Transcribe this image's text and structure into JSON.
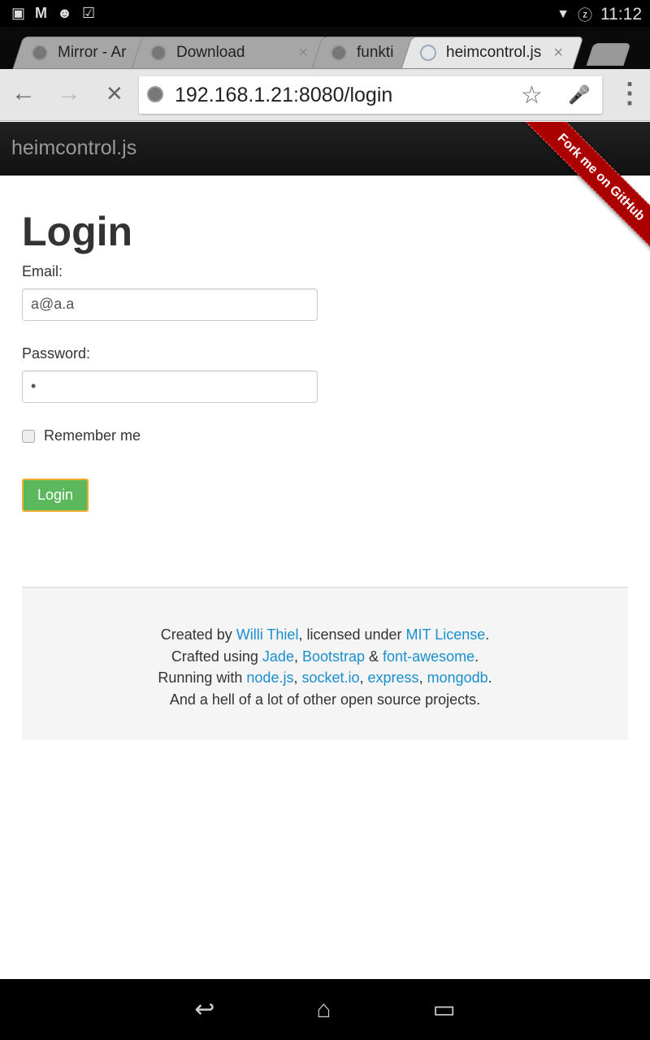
{
  "status_bar": {
    "icons": [
      "gallery-icon",
      "gmail-icon",
      "cyanogen-icon",
      "shopping-bag-icon"
    ],
    "wifi": "wifi-icon",
    "battery": "battery-charging-icon",
    "time": "11:12"
  },
  "tabs": [
    {
      "title": "Mirror - Ar"
    },
    {
      "title": "Download",
      "close": "×"
    },
    {
      "title": "funkti"
    },
    {
      "title": "heimcontrol.js",
      "close": "×",
      "active": true
    }
  ],
  "toolbar": {
    "back": "←",
    "forward": "→",
    "stop": "✕",
    "url": "192.168.1.21:8080/login",
    "star": "☆",
    "mic": "🎤",
    "menu": "⋮"
  },
  "navbar": {
    "brand": "heimcontrol.js",
    "ribbon": "Fork me on GitHub"
  },
  "login": {
    "title": "Login",
    "email_label": "Email:",
    "email_value": "a@a.a",
    "password_label": "Password:",
    "password_value": "•",
    "remember_label": "Remember me",
    "submit": "Login",
    "button_color": "#5cb85c"
  },
  "footer": {
    "lines": [
      [
        {
          "t": "Created by "
        },
        {
          "t": "Willi Thiel",
          "link": true
        },
        {
          "t": ", licensed under "
        },
        {
          "t": "MIT License",
          "link": true
        },
        {
          "t": "."
        }
      ],
      [
        {
          "t": "Crafted using "
        },
        {
          "t": "Jade",
          "link": true
        },
        {
          "t": ", "
        },
        {
          "t": "Bootstrap",
          "link": true
        },
        {
          "t": " & "
        },
        {
          "t": "font-awesome",
          "link": true
        },
        {
          "t": "."
        }
      ],
      [
        {
          "t": "Running with "
        },
        {
          "t": "node.js",
          "link": true
        },
        {
          "t": ", "
        },
        {
          "t": "socket.io",
          "link": true
        },
        {
          "t": ", "
        },
        {
          "t": "express",
          "link": true
        },
        {
          "t": ", "
        },
        {
          "t": "mongodb",
          "link": true
        },
        {
          "t": "."
        }
      ],
      [
        {
          "t": "And a hell of a lot of other open source projects."
        }
      ]
    ],
    "link_color": "#1a8fd0"
  },
  "system_nav": {
    "back": "back-icon",
    "home": "home-icon",
    "recents": "recents-icon"
  }
}
